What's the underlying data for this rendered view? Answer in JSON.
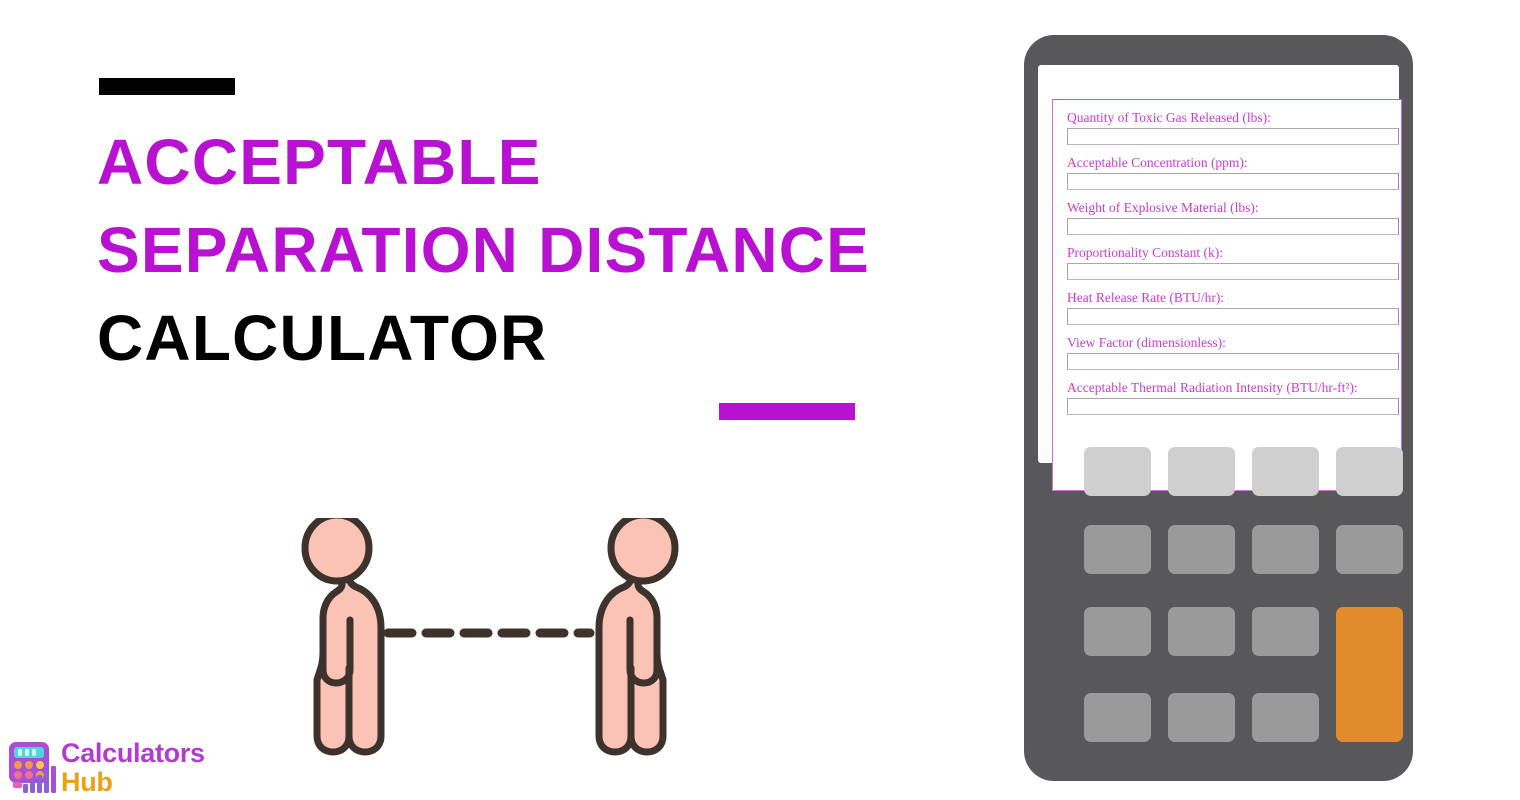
{
  "page": {
    "background_color": "#ffffff",
    "accent_color": "#b811d1",
    "calculator_body_color": "#58585a",
    "accent_key_color": "#e28b2a"
  },
  "hero": {
    "accent_bar_top_color": "#000000",
    "accent_bar_bottom_color": "#b811d1",
    "title_lines": [
      {
        "text": "ACCEPTABLE",
        "color": "#b811d1"
      },
      {
        "text": "SEPARATION DISTANCE",
        "color": "#b811d1"
      },
      {
        "text": "CALCULATOR",
        "color": "#000000"
      }
    ]
  },
  "illustration": {
    "name": "two-people-separation-distance",
    "person_fill": "#fbc3b5",
    "person_outline": "#3d322c",
    "dash_color": "#3d322c",
    "dash_count": 6
  },
  "logo": {
    "word_1": "Calculators",
    "word_2": "Hub",
    "word_1_color": "#b23bd1",
    "word_2_color": "#e8a317",
    "icon": "calculator-bar-chart-icon"
  },
  "calculator": {
    "form": {
      "fields": [
        {
          "label": "Quantity of Toxic Gas Released (lbs):",
          "value": "",
          "placeholder": ""
        },
        {
          "label": "Acceptable Concentration (ppm):",
          "value": "",
          "placeholder": ""
        },
        {
          "label": "Weight of Explosive Material (lbs):",
          "value": "",
          "placeholder": ""
        },
        {
          "label": "Proportionality Constant (k):",
          "value": "",
          "placeholder": ""
        },
        {
          "label": "Heat Release Rate (BTU/hr):",
          "value": "",
          "placeholder": ""
        },
        {
          "label": "View Factor (dimensionless):",
          "value": "",
          "placeholder": ""
        },
        {
          "label": "Acceptable Thermal Radiation Intensity (BTU/hr-ft²):",
          "value": "",
          "placeholder": ""
        }
      ],
      "label_color": "#cc3bd6",
      "border_color": "#d46ce0"
    },
    "keypad": {
      "rows": 4,
      "cols": 4,
      "keys": [
        {
          "style": "light",
          "label": ""
        },
        {
          "style": "light",
          "label": ""
        },
        {
          "style": "light",
          "label": ""
        },
        {
          "style": "light",
          "label": ""
        },
        {
          "style": "grey",
          "label": ""
        },
        {
          "style": "grey",
          "label": ""
        },
        {
          "style": "grey",
          "label": ""
        },
        {
          "style": "grey",
          "label": ""
        },
        {
          "style": "grey",
          "label": ""
        },
        {
          "style": "grey",
          "label": ""
        },
        {
          "style": "grey",
          "label": ""
        },
        {
          "style": "accent",
          "label": ""
        },
        {
          "style": "grey",
          "label": ""
        },
        {
          "style": "grey",
          "label": ""
        },
        {
          "style": "grey",
          "label": ""
        }
      ]
    }
  }
}
